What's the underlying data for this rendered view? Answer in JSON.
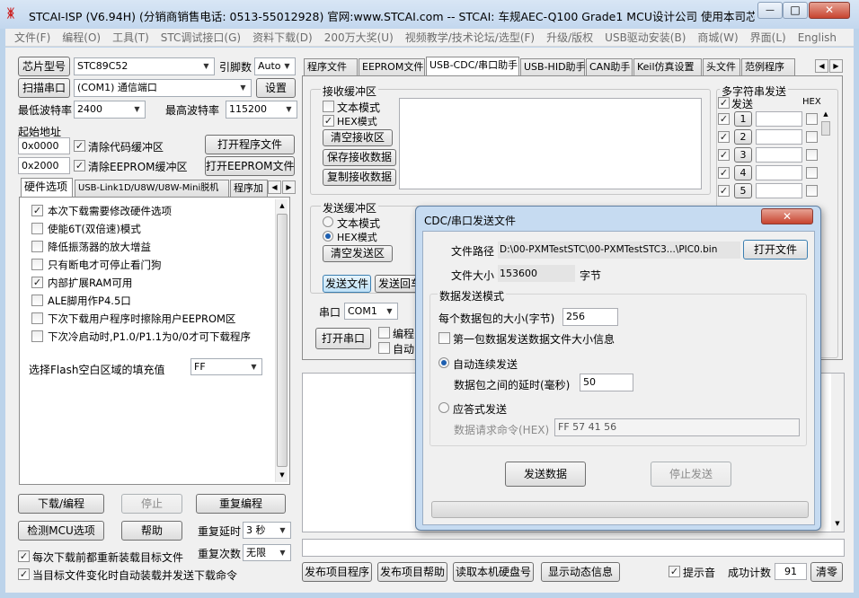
{
  "window": {
    "title": "STCAI-ISP (V6.94H) (分销商销售电话: 0513-55012928) 官网:www.STCAI.com  -- STCAI: 车规AEC-Q100 Grade1 MCU设计公司 使用本司芯片或采...",
    "minimize": "—",
    "maximize": "□",
    "close": "✕"
  },
  "menu": [
    "文件(F)",
    "编程(O)",
    "工具(T)",
    "STC调试接口(G)",
    "资料下载(D)",
    "200万大奖(U)",
    "视频教学/技术论坛/选型(F)",
    "升级/版权",
    "USB驱动安装(B)",
    "商城(W)",
    "界面(L)",
    "English"
  ],
  "left": {
    "chip_label": "芯片型号",
    "chip_value": "STC89C52",
    "pin_label": "引脚数",
    "pin_value": "Auto",
    "scan_port": "扫描串口",
    "port_value": "(COM1) 通信端口",
    "settings": "设置",
    "min_baud_label": "最低波特率",
    "min_baud": "2400",
    "max_baud_label": "最高波特率",
    "max_baud": "115200",
    "start_addr_label": "起始地址",
    "addr1": "0x0000",
    "clear_code": "清除代码缓冲区",
    "open_program": "打开程序文件",
    "addr2": "0x2000",
    "clear_eeprom": "清除EEPROM缓冲区",
    "open_eeprom": "打开EEPROM文件",
    "tabs": [
      "硬件选项",
      "USB-Link1D/U8W/U8W-Mini脱机",
      "程序加"
    ],
    "options": [
      {
        "label": "本次下载需要修改硬件选项",
        "checked": true
      },
      {
        "label": "使能6T(双倍速)模式",
        "checked": false
      },
      {
        "label": "降低振荡器的放大增益",
        "checked": false
      },
      {
        "label": "只有断电才可停止看门狗",
        "checked": false
      },
      {
        "label": "内部扩展RAM可用",
        "checked": true
      },
      {
        "label": "ALE脚用作P4.5口",
        "checked": false
      },
      {
        "label": "下次下载用户程序时擦除用户EEPROM区",
        "checked": false
      },
      {
        "label": "下次冷启动时,P1.0/P1.1为0/0才可下载程序",
        "checked": false
      }
    ],
    "flash_fill_label": "选择Flash空白区域的填充值",
    "flash_fill_value": "FF",
    "download": "下载/编程",
    "stop": "停止",
    "repeat_program": "重复编程",
    "detect": "检测MCU选项",
    "help": "帮助",
    "repeat_delay_label": "重复延时",
    "repeat_delay": "3 秒",
    "repeat_count_label": "重复次数",
    "repeat_count": "无限",
    "reload_each": "每次下载前都重新装载目标文件",
    "auto_load": "当目标文件变化时自动装载并发送下载命令"
  },
  "right_tabs": [
    "程序文件",
    "EEPROM文件",
    "USB-CDC/串口助手",
    "USB-HID助手",
    "CAN助手",
    "Keil仿真设置",
    "头文件",
    "范例程序"
  ],
  "assistant": {
    "recv_group": "接收缓冲区",
    "text_mode": "文本模式",
    "hex_mode": "HEX模式",
    "clear_recv": "清空接收区",
    "save_recv": "保存接收数据",
    "copy_recv": "复制接收数据",
    "send_group": "发送缓冲区",
    "clear_send": "清空发送区",
    "send_file": "发送文件",
    "send_back": "发送回车",
    "port_label": "串口",
    "port": "COM1",
    "open_port": "打开串口",
    "prog_partial": "编程",
    "auto_partial": "自动",
    "multi_label": "多字符串发送",
    "send_col": "发送",
    "hex_col": "HEX",
    "rows": [
      "1",
      "2",
      "3",
      "4",
      "5"
    ]
  },
  "bottom": {
    "publish": "发布项目程序",
    "publish_help": "发布项目帮助",
    "read_disk": "读取本机硬盘号",
    "show_dynamic": "显示动态信息",
    "beep": "提示音",
    "success_label": "成功计数",
    "success_count": "91",
    "clear": "清零"
  },
  "dialog": {
    "title": "CDC/串口发送文件",
    "path_label": "文件路径",
    "path": "D:\\00-PXMTestSTC\\00-PXMTestSTC3...\\PIC0.bin",
    "open_file": "打开文件",
    "size_label": "文件大小",
    "size": "153600",
    "size_unit": "字节",
    "mode_group": "数据发送模式",
    "packet_label": "每个数据包的大小(字节)",
    "packet_size": "256",
    "first_packet": "第一包数据发送数据文件大小信息",
    "auto_send": "自动连续发送",
    "delay_label": "数据包之间的延时(毫秒)",
    "delay": "50",
    "ack_send": "应答式发送",
    "request_label": "数据请求命令(HEX)",
    "request_cmd": "FF 57 41 56",
    "send_data": "发送数据",
    "stop_send": "停止发送",
    "progress": 0
  }
}
